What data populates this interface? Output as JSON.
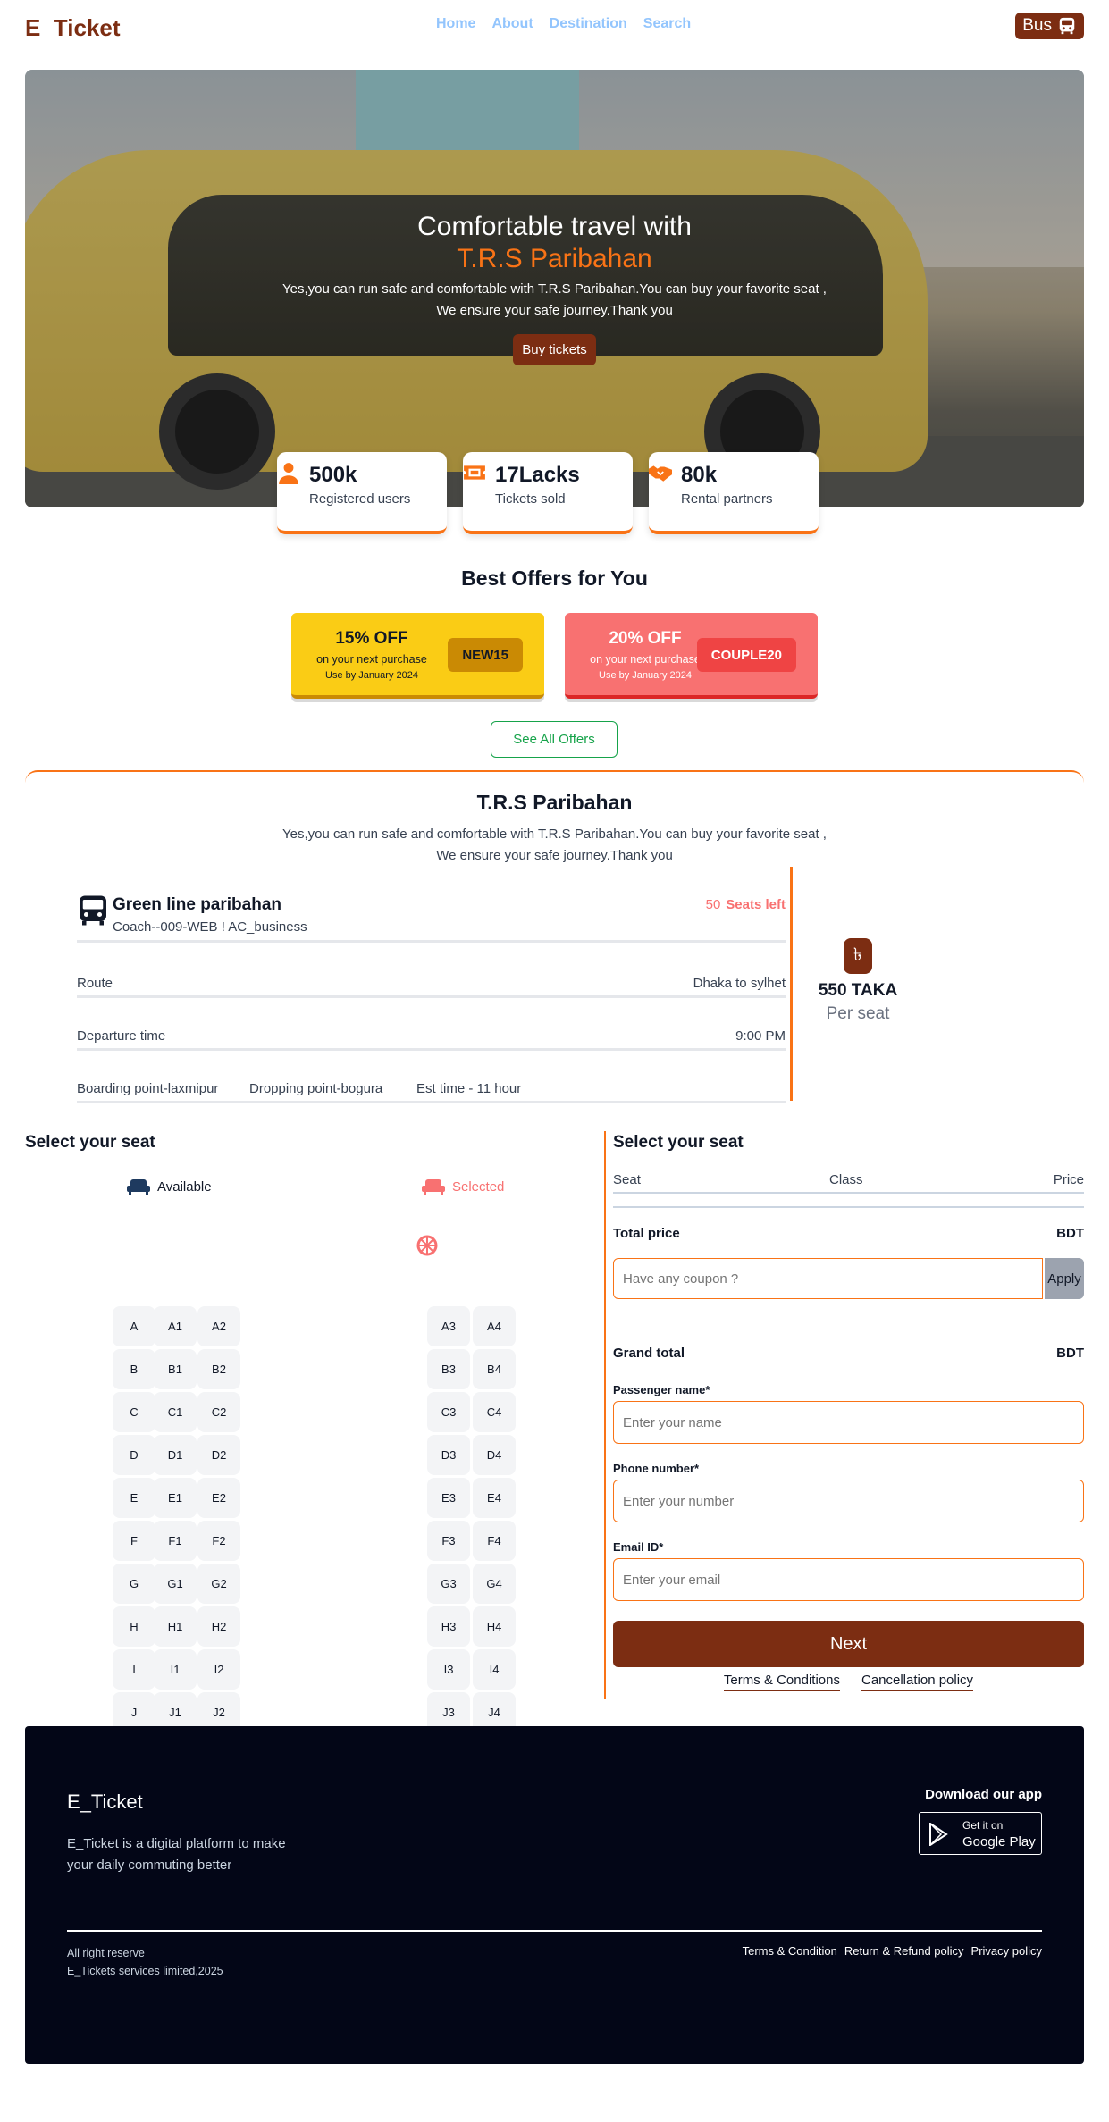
{
  "brand": "E_Ticket",
  "nav": {
    "links": [
      "Home",
      "About",
      "Destination",
      "Search"
    ],
    "bus_label": "Bus"
  },
  "hero": {
    "title_line1": "Comfortable travel with",
    "title_line2": "T.R.S Paribahan",
    "desc_line1": "Yes,you can run safe and comfortable with T.R.S Paribahan.You can buy your favorite seat ,",
    "desc_line2": "We ensure your safe journey.Thank you",
    "cta": "Buy tickets"
  },
  "stats": [
    {
      "icon": "user-icon",
      "value": "500k",
      "label": "Registered users"
    },
    {
      "icon": "ticket-icon",
      "value": "17Lacks",
      "label": "Tickets sold"
    },
    {
      "icon": "handshake-icon",
      "value": "80k",
      "label": "Rental partners"
    }
  ],
  "offers": {
    "title": "Best Offers for You",
    "items": [
      {
        "title": "15% OFF",
        "sub": "on your next purchase",
        "date": "Use by January 2024",
        "code": "NEW15"
      },
      {
        "title": "20% OFF",
        "sub": "on your next purchase",
        "date": "Use by January 2024",
        "code": "COUPLE20"
      }
    ],
    "see_all": "See All Offers"
  },
  "operator": {
    "title": "T.R.S Paribahan",
    "desc_line1": "Yes,you can run safe and comfortable with T.R.S Paribahan.You can buy your favorite seat ,",
    "desc_line2": "We ensure your safe journey.Thank you",
    "bus_name": "Green line paribahan",
    "coach": "Coach--009-WEB ! AC_business",
    "seats_count": "50",
    "seats_left_label": "Seats left",
    "route_label": "Route",
    "route_value": "Dhaka to sylhet",
    "departure_label": "Departure time",
    "departure_value": "9:00 PM",
    "boarding": "Boarding point-laxmipur",
    "dropping": "Dropping point-bogura",
    "est_time": "Est time - 11 hour",
    "currency_symbol": "৳",
    "price": "550 TAKA",
    "per_seat": "Per seat"
  },
  "seat_select": {
    "title": "Select your seat",
    "legend_available": "Available",
    "legend_selected": "Selected",
    "rows": [
      [
        "A",
        "A1",
        "A2",
        "A3",
        "A4"
      ],
      [
        "B",
        "B1",
        "B2",
        "B3",
        "B4"
      ],
      [
        "C",
        "C1",
        "C2",
        "C3",
        "C4"
      ],
      [
        "D",
        "D1",
        "D2",
        "D3",
        "D4"
      ],
      [
        "E",
        "E1",
        "E2",
        "E3",
        "E4"
      ],
      [
        "F",
        "F1",
        "F2",
        "F3",
        "F4"
      ],
      [
        "G",
        "G1",
        "G2",
        "G3",
        "G4"
      ],
      [
        "H",
        "H1",
        "H2",
        "H3",
        "H4"
      ],
      [
        "I",
        "I1",
        "I2",
        "I3",
        "I4"
      ],
      [
        "J",
        "J1",
        "J2",
        "J3",
        "J4"
      ]
    ]
  },
  "summary": {
    "title": "Select your seat",
    "col_seat": "Seat",
    "col_class": "Class",
    "col_price": "Price",
    "total_label": "Total price",
    "total_value": "BDT",
    "coupon_placeholder": "Have any coupon ?",
    "apply": "Apply",
    "grand_label": "Grand total",
    "grand_value": "BDT",
    "name_label": "Passenger name*",
    "name_placeholder": "Enter your name",
    "phone_label": "Phone number*",
    "phone_placeholder": "Enter your number",
    "email_label": "Email ID*",
    "email_placeholder": "Enter your email",
    "next": "Next",
    "terms": "Terms & Conditions",
    "cancellation": "Cancellation policy"
  },
  "footer": {
    "logo": "E_Ticket",
    "desc": "E_Ticket is a digital platform to make your daily commuting better",
    "download": "Download our app",
    "get_it_on": "Get it on",
    "store": "Google Play",
    "rights": "All right reserve",
    "company": "E_Tickets services limited,2025",
    "links": [
      "Terms & Condition",
      "Return & Refund policy",
      "Privacy policy"
    ]
  },
  "colors": {
    "brand": "#7c2d12",
    "accent": "#f97316",
    "nav_link": "#93c5fd",
    "danger": "#f87171"
  }
}
